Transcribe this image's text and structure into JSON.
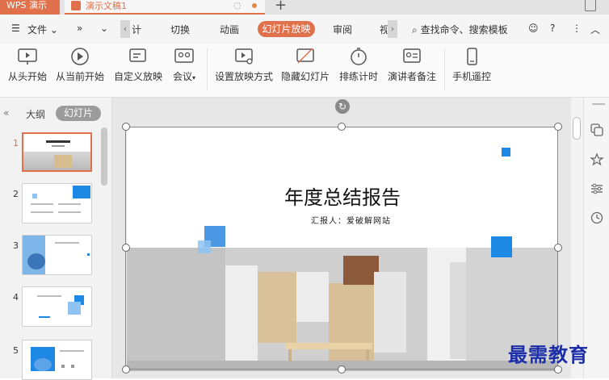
{
  "app": {
    "name": "WPS 演示",
    "doc_tab": "演示文稿1"
  },
  "menu": {
    "file": "文件",
    "items": [
      "计",
      "切换",
      "动画",
      "幻灯片放映",
      "审阅",
      "视"
    ],
    "active": "幻灯片放映",
    "search": "查找命令、搜索模板"
  },
  "ribbon": {
    "buttons": [
      {
        "label": "从头开始",
        "icon": "play-from-start-icon"
      },
      {
        "label": "从当前开始",
        "icon": "play-circle-icon"
      },
      {
        "label": "自定义放映",
        "icon": "custom-show-icon"
      },
      {
        "label": "会议",
        "icon": "meeting-icon"
      },
      {
        "label": "设置放映方式",
        "icon": "slideshow-settings-icon"
      },
      {
        "label": "隐藏幻灯片",
        "icon": "hide-slide-icon"
      },
      {
        "label": "排练计时",
        "icon": "stopwatch-icon"
      },
      {
        "label": "演讲者备注",
        "icon": "speaker-notes-icon"
      },
      {
        "label": "手机遥控",
        "icon": "phone-remote-icon"
      }
    ]
  },
  "left_panel": {
    "tabs": [
      "大纲",
      "幻灯片"
    ],
    "active_tab": "幻灯片",
    "slides": [
      {
        "number": "1",
        "selected": true
      },
      {
        "number": "2",
        "selected": false
      },
      {
        "number": "3",
        "selected": false
      },
      {
        "number": "4",
        "selected": false
      },
      {
        "number": "5",
        "selected": false
      }
    ]
  },
  "slide": {
    "title": "年度总结报告",
    "subtitle": "汇报人：爱破解网站"
  },
  "watermark": "最需教育",
  "colors": {
    "accent": "#e0714c",
    "blue": "#1e88e5",
    "light_blue": "#8ec3f3"
  }
}
